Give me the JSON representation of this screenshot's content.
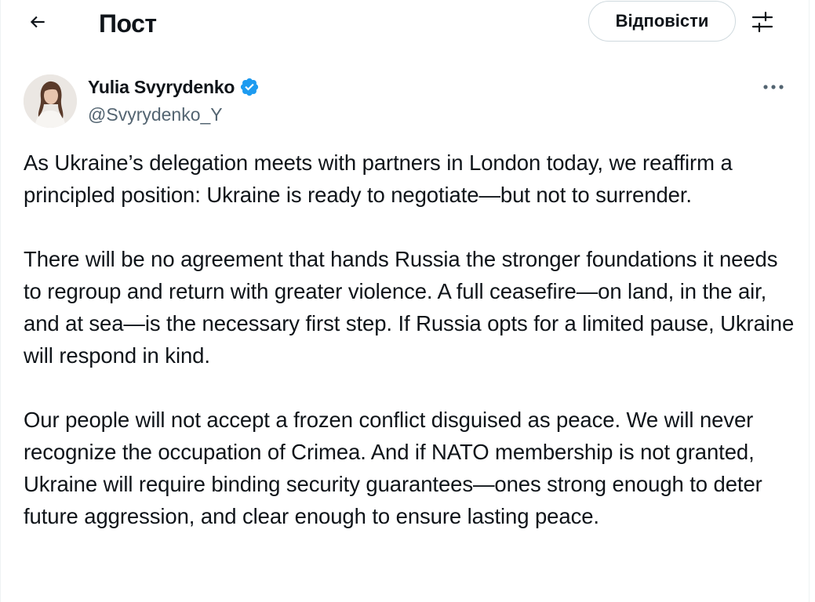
{
  "header": {
    "title": "Пост",
    "reply_label": "Відповісти",
    "back_icon": "arrow-left-icon",
    "filter_icon": "sliders-icon"
  },
  "author": {
    "name": "Yulia Svyrydenko",
    "handle": "@Svyrydenko_Y",
    "verified": true,
    "verified_color": "#1d9bf0",
    "avatar_icon": "avatar-photo",
    "more_icon": "more-dots-icon"
  },
  "post": {
    "paragraphs": [
      "As Ukraine’s delegation meets with partners in London today, we reaffirm a principled position: Ukraine is ready to negotiate—but not to surrender.",
      "There will be no agreement that hands Russia the stronger foundations it needs to regroup and return with greater violence. A full ceasefire—on land, in the air, and at sea—is the necessary first step. If Russia opts for a limited pause, Ukraine will respond in kind.",
      "Our people will not accept a frozen conflict disguised as peace. We will never recognize the occupation of Crimea. And if NATO membership is not granted, Ukraine will require binding security guarantees—ones strong enough to deter future aggression, and clear enough to ensure lasting peace."
    ]
  },
  "colors": {
    "text": "#0f1419",
    "secondary_text": "#536471",
    "border": "#cfd9de",
    "accent": "#1d9bf0"
  }
}
